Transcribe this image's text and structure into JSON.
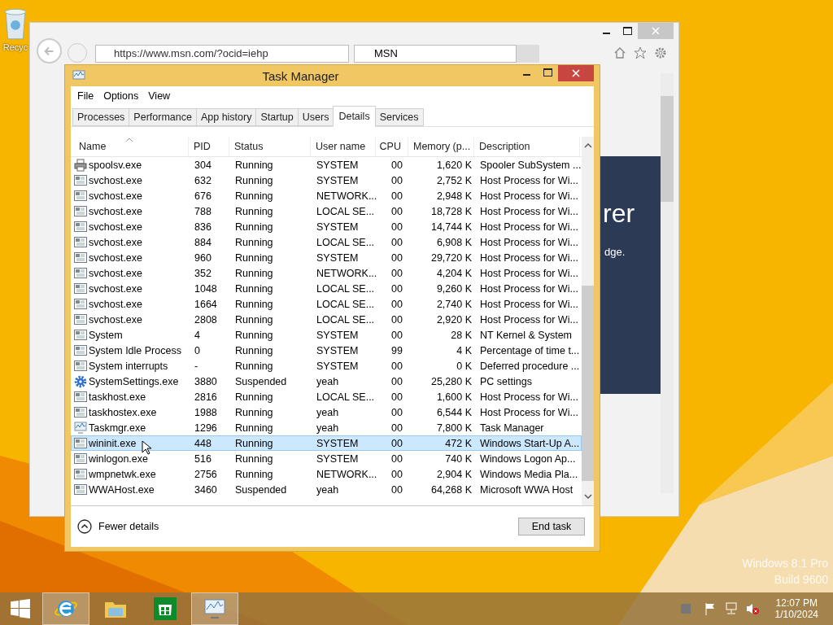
{
  "desktop": {
    "recycle_bin": {
      "label": "Recyc"
    },
    "edition": "Windows 8.1 Pro",
    "build": "Build 9600"
  },
  "browser": {
    "address": "https://www.msn.com/?ocid=iehp",
    "tab": {
      "title": "MSN"
    },
    "page": {
      "heading": "rer",
      "text": "dge."
    }
  },
  "task_manager": {
    "title": "Task Manager",
    "menu": [
      "File",
      "Options",
      "View"
    ],
    "tabs": [
      {
        "label": "Processes",
        "selected": false
      },
      {
        "label": "Performance",
        "selected": false
      },
      {
        "label": "App history",
        "selected": false
      },
      {
        "label": "Startup",
        "selected": false
      },
      {
        "label": "Users",
        "selected": false
      },
      {
        "label": "Details",
        "selected": true
      },
      {
        "label": "Services",
        "selected": false
      }
    ],
    "columns": [
      {
        "label": "Name",
        "sorted": true
      },
      {
        "label": "PID",
        "sorted": false
      },
      {
        "label": "Status",
        "sorted": false
      },
      {
        "label": "User name",
        "sorted": false
      },
      {
        "label": "CPU",
        "sorted": false
      },
      {
        "label": "Memory (p...",
        "sorted": false
      },
      {
        "label": "Description",
        "sorted": false
      }
    ],
    "rows": [
      {
        "kind": "printer",
        "name": "spoolsv.exe",
        "pid": "304",
        "status": "Running",
        "user": "SYSTEM",
        "cpu": "00",
        "memory": "1,620 K",
        "description": "Spooler SubSystem ...",
        "selected": false
      },
      {
        "kind": "service",
        "name": "svchost.exe",
        "pid": "632",
        "status": "Running",
        "user": "SYSTEM",
        "cpu": "00",
        "memory": "2,752 K",
        "description": "Host Process for Wi...",
        "selected": false
      },
      {
        "kind": "service",
        "name": "svchost.exe",
        "pid": "676",
        "status": "Running",
        "user": "NETWORK...",
        "cpu": "00",
        "memory": "2,948 K",
        "description": "Host Process for Wi...",
        "selected": false
      },
      {
        "kind": "service",
        "name": "svchost.exe",
        "pid": "788",
        "status": "Running",
        "user": "LOCAL SE...",
        "cpu": "00",
        "memory": "18,728 K",
        "description": "Host Process for Wi...",
        "selected": false
      },
      {
        "kind": "service",
        "name": "svchost.exe",
        "pid": "836",
        "status": "Running",
        "user": "SYSTEM",
        "cpu": "00",
        "memory": "14,744 K",
        "description": "Host Process for Wi...",
        "selected": false
      },
      {
        "kind": "service",
        "name": "svchost.exe",
        "pid": "884",
        "status": "Running",
        "user": "LOCAL SE...",
        "cpu": "00",
        "memory": "6,908 K",
        "description": "Host Process for Wi...",
        "selected": false
      },
      {
        "kind": "service",
        "name": "svchost.exe",
        "pid": "960",
        "status": "Running",
        "user": "SYSTEM",
        "cpu": "00",
        "memory": "29,720 K",
        "description": "Host Process for Wi...",
        "selected": false
      },
      {
        "kind": "service",
        "name": "svchost.exe",
        "pid": "352",
        "status": "Running",
        "user": "NETWORK...",
        "cpu": "00",
        "memory": "4,204 K",
        "description": "Host Process for Wi...",
        "selected": false
      },
      {
        "kind": "service",
        "name": "svchost.exe",
        "pid": "1048",
        "status": "Running",
        "user": "LOCAL SE...",
        "cpu": "00",
        "memory": "9,260 K",
        "description": "Host Process for Wi...",
        "selected": false
      },
      {
        "kind": "service",
        "name": "svchost.exe",
        "pid": "1664",
        "status": "Running",
        "user": "LOCAL SE...",
        "cpu": "00",
        "memory": "2,740 K",
        "description": "Host Process for Wi...",
        "selected": false
      },
      {
        "kind": "service",
        "name": "svchost.exe",
        "pid": "2808",
        "status": "Running",
        "user": "LOCAL SE...",
        "cpu": "00",
        "memory": "2,920 K",
        "description": "Host Process for Wi...",
        "selected": false
      },
      {
        "kind": "service",
        "name": "System",
        "pid": "4",
        "status": "Running",
        "user": "SYSTEM",
        "cpu": "00",
        "memory": "28 K",
        "description": "NT Kernel & System",
        "selected": false
      },
      {
        "kind": "service",
        "name": "System Idle Process",
        "pid": "0",
        "status": "Running",
        "user": "SYSTEM",
        "cpu": "99",
        "memory": "4 K",
        "description": "Percentage of time t...",
        "selected": false
      },
      {
        "kind": "service",
        "name": "System interrupts",
        "pid": "-",
        "status": "Running",
        "user": "SYSTEM",
        "cpu": "00",
        "memory": "0 K",
        "description": "Deferred procedure ...",
        "selected": false
      },
      {
        "kind": "gear",
        "name": "SystemSettings.exe",
        "pid": "3880",
        "status": "Suspended",
        "user": "yeah",
        "cpu": "00",
        "memory": "25,280 K",
        "description": "PC settings",
        "selected": false
      },
      {
        "kind": "service",
        "name": "taskhost.exe",
        "pid": "2816",
        "status": "Running",
        "user": "LOCAL SE...",
        "cpu": "00",
        "memory": "1,600 K",
        "description": "Host Process for Wi...",
        "selected": false
      },
      {
        "kind": "service",
        "name": "taskhostex.exe",
        "pid": "1988",
        "status": "Running",
        "user": "yeah",
        "cpu": "00",
        "memory": "6,544 K",
        "description": "Host Process for Wi...",
        "selected": false
      },
      {
        "kind": "monitor",
        "name": "Taskmgr.exe",
        "pid": "1296",
        "status": "Running",
        "user": "yeah",
        "cpu": "00",
        "memory": "7,800 K",
        "description": "Task Manager",
        "selected": false
      },
      {
        "kind": "service",
        "name": "wininit.exe",
        "pid": "448",
        "status": "Running",
        "user": "SYSTEM",
        "cpu": "00",
        "memory": "472 K",
        "description": "Windows Start-Up A...",
        "selected": true
      },
      {
        "kind": "service",
        "name": "winlogon.exe",
        "pid": "516",
        "status": "Running",
        "user": "SYSTEM",
        "cpu": "00",
        "memory": "740 K",
        "description": "Windows Logon Ap...",
        "selected": false
      },
      {
        "kind": "service",
        "name": "wmpnetwk.exe",
        "pid": "2756",
        "status": "Running",
        "user": "NETWORK...",
        "cpu": "00",
        "memory": "2,904 K",
        "description": "Windows Media Pla...",
        "selected": false
      },
      {
        "kind": "service",
        "name": "WWAHost.exe",
        "pid": "3460",
        "status": "Suspended",
        "user": "yeah",
        "cpu": "00",
        "memory": "64,268 K",
        "description": "Microsoft WWA Host",
        "selected": false
      }
    ],
    "fewer_details": "Fewer details",
    "end_task": "End task"
  },
  "taskbar": {
    "apps": [
      {
        "kind": "ie",
        "selected": true
      },
      {
        "kind": "explorer",
        "selected": false
      },
      {
        "kind": "store",
        "selected": false
      },
      {
        "kind": "taskmgr",
        "selected": true
      }
    ],
    "time": "12:07 PM",
    "date": "1/10/2024"
  }
}
